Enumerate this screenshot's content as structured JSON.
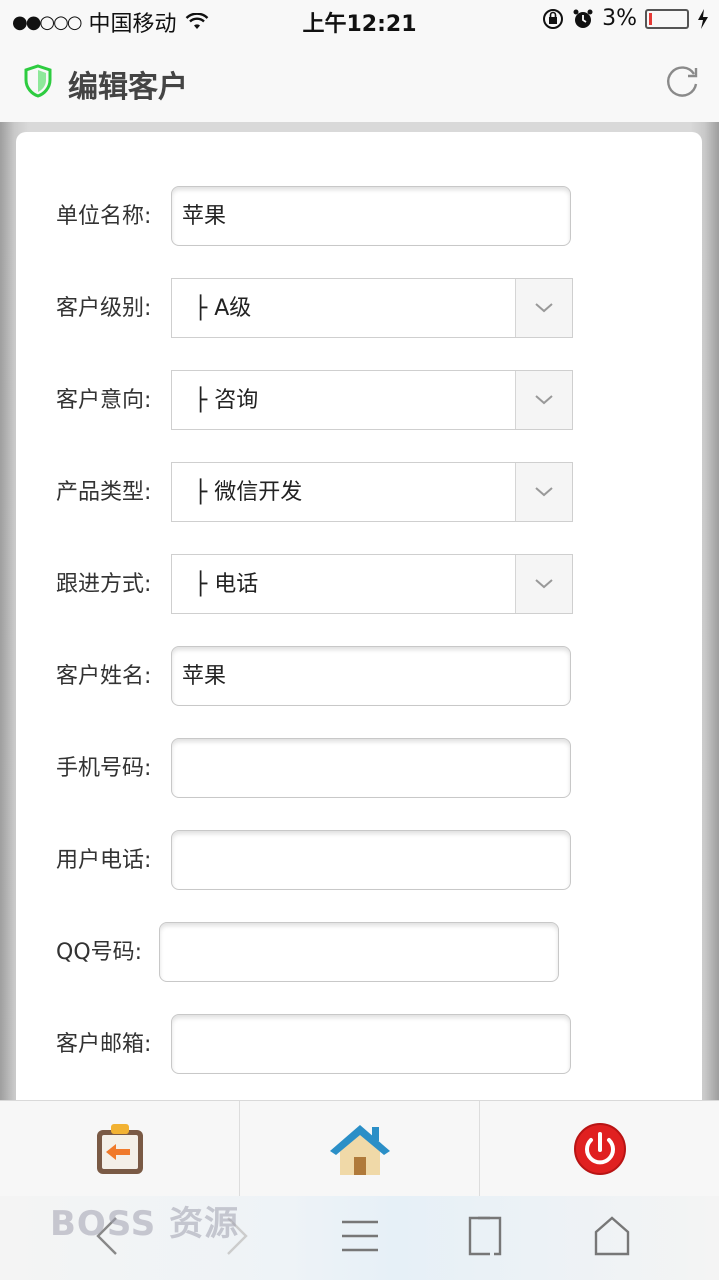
{
  "status_bar": {
    "carrier": "中国移动",
    "time": "上午12:21",
    "battery": "3%"
  },
  "header": {
    "title": "编辑客户"
  },
  "form": {
    "fields": [
      {
        "label": "单位名称:",
        "type": "text",
        "value": "苹果"
      },
      {
        "label": "客户级别:",
        "type": "select",
        "value": "├ A级"
      },
      {
        "label": "客户意向:",
        "type": "select",
        "value": "├ 咨询"
      },
      {
        "label": "产品类型:",
        "type": "select",
        "value": "├ 微信开发"
      },
      {
        "label": "跟进方式:",
        "type": "select",
        "value": "├ 电话"
      },
      {
        "label": "客户姓名:",
        "type": "text",
        "value": "苹果"
      },
      {
        "label": "手机号码:",
        "type": "text",
        "value": ""
      },
      {
        "label": "用户电话:",
        "type": "text",
        "value": ""
      },
      {
        "label": "QQ号码:",
        "type": "text",
        "value": ""
      },
      {
        "label": "客户邮箱:",
        "type": "text",
        "value": ""
      }
    ]
  },
  "toolbar": {
    "items": [
      {
        "icon": "back-clipboard-icon"
      },
      {
        "icon": "home-icon"
      },
      {
        "icon": "power-icon"
      }
    ]
  },
  "watermark": "BOSS 资源",
  "colors": {
    "shield": "#2ecc40",
    "power": "#e02020",
    "home_roof": "#2b8fc7"
  }
}
